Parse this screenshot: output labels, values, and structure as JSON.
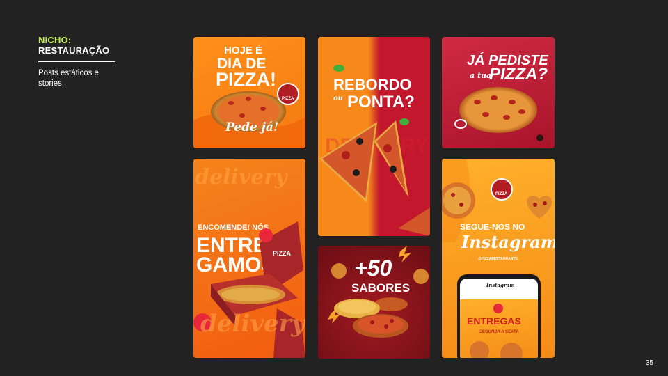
{
  "sidebar": {
    "title_line1": "NICHO:",
    "title_line2": "RESTAURAÇÃO",
    "description": "Posts estáticos e stories."
  },
  "page_number": "35",
  "posts": {
    "p1": {
      "line1": "HOJE É",
      "line2": "DIA DE",
      "line3": "PIZZA!",
      "tagline": "Pede já!",
      "badge": "PIZZA"
    },
    "p2": {
      "line1": "ENCOMENDE! NÓS",
      "line2": "ENTRE",
      "line3": "GAMOS",
      "box_label": "PIZZA",
      "bg_word": "delivery"
    },
    "p3": {
      "line1": "REBORDO",
      "connector": "ou",
      "line2": "PONTA?",
      "bg_word": "DELIVERY"
    },
    "p4": {
      "line1": "+50",
      "line2": "SABORES"
    },
    "p5": {
      "line1": "JÁ PEDISTE",
      "connector": "a tua",
      "line2": "PIZZA?"
    },
    "p6": {
      "line1": "SEGUE-NOS NO",
      "line2": "Instagram",
      "handle": "@PIZZARESTAURANTE_",
      "phone_app": "Instagram",
      "phone_title": "ENTREGAS",
      "phone_sub": "SEGUNDA A SEXTA",
      "badge": "PIZZA"
    }
  },
  "colors": {
    "accent": "#c8f25a",
    "background": "#222222",
    "orange": "#f7891a",
    "red": "#c2172c"
  }
}
